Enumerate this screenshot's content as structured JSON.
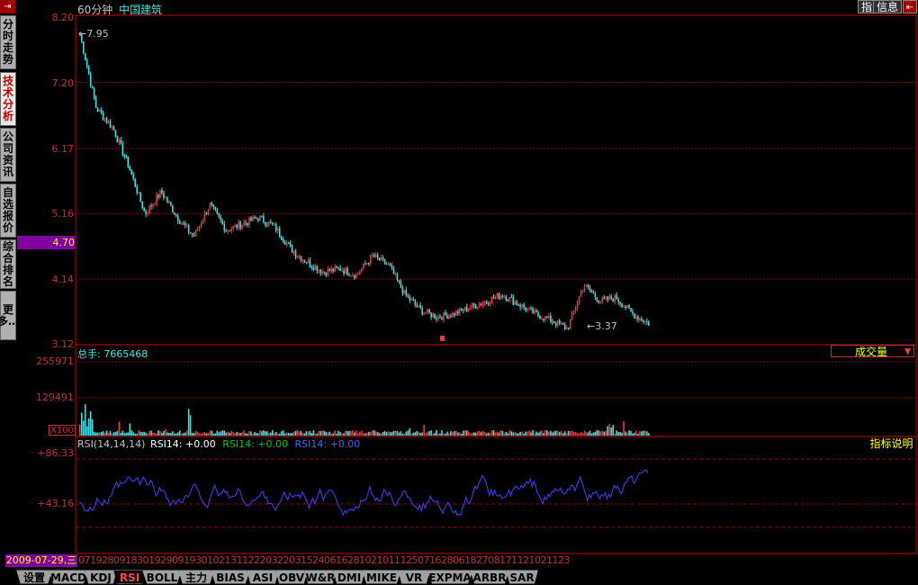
{
  "header": {
    "period": "60分钟",
    "stock_name": "中国建筑",
    "btn_indicator": "指",
    "btn_info": "信息",
    "close_icon": "exit-icon"
  },
  "sidebar": {
    "tabs": [
      {
        "label": "分时走势",
        "active": false
      },
      {
        "label": "技术分析",
        "active": true
      },
      {
        "label": "公司资讯",
        "active": false
      },
      {
        "label": "自选报价",
        "active": false
      },
      {
        "label": "综合排名",
        "active": false
      },
      {
        "label": "更多…",
        "active": false
      }
    ]
  },
  "price_panel": {
    "y_ticks": [
      "8.20",
      "7.20",
      "6.17",
      "5.16",
      "4.14",
      "3.12"
    ],
    "highlight_price": "4.70",
    "high_marker": "7.95",
    "low_marker": "3.37"
  },
  "volume_panel": {
    "title": "总手: 7665468",
    "y_ticks": [
      "255971",
      "129491"
    ],
    "unit": "X100",
    "dropdown_label": "成交量"
  },
  "rsi_panel": {
    "title": "RSI(14,14,14)",
    "rsi1": "RSI14: +0.00",
    "rsi2": "RSI14: +0.00",
    "rsi3": "RSI14: +0.00",
    "y_ticks": [
      "+86.33",
      "+43.16"
    ],
    "help_button": "指标说明"
  },
  "time_axis": {
    "current_date": "2009-07-29,三",
    "labels": [
      "07",
      "19",
      "28",
      "09",
      "18",
      "30",
      "19",
      "29",
      "09",
      "19",
      "30",
      "10",
      "21",
      "31",
      "12",
      "22",
      "03",
      "22",
      "03",
      "15",
      "24",
      "06",
      "16",
      "28",
      "10",
      "21",
      "01",
      "11",
      "25",
      "07",
      "16",
      "28",
      "06",
      "18",
      "27",
      "08",
      "17",
      "11",
      "21",
      "02",
      "11",
      "23"
    ]
  },
  "bottom_tabs": [
    "设置",
    "MACD",
    "KDJ",
    "RSI",
    "BOLL",
    "主力",
    "BIAS",
    "ASI",
    "OBV",
    "W&R",
    "DMI",
    "MIKE",
    "VR",
    "EXPMA",
    "ARBR",
    "SAR"
  ],
  "active_bottom_tab": "RSI",
  "colors": {
    "up": "#ff3030",
    "down": "#40e0e0",
    "rsi": "#4040ff",
    "grid": "#900000",
    "highlight": "#8000a0"
  },
  "chart_data": {
    "type": "candlestick",
    "price_anchors": [
      7.95,
      6.8,
      6.5,
      5.9,
      5.15,
      5.5,
      5.1,
      4.8,
      5.3,
      4.9,
      5.0,
      5.1,
      4.95,
      4.6,
      4.4,
      4.25,
      4.3,
      4.2,
      4.5,
      4.35,
      3.9,
      3.65,
      3.55,
      3.6,
      3.7,
      3.8,
      3.9,
      3.75,
      3.6,
      3.5,
      3.37,
      4.05,
      3.8,
      3.85,
      3.6,
      3.45
    ],
    "rsi_range": [
      0,
      86.33
    ],
    "ylim": [
      3.12,
      8.2
    ]
  }
}
